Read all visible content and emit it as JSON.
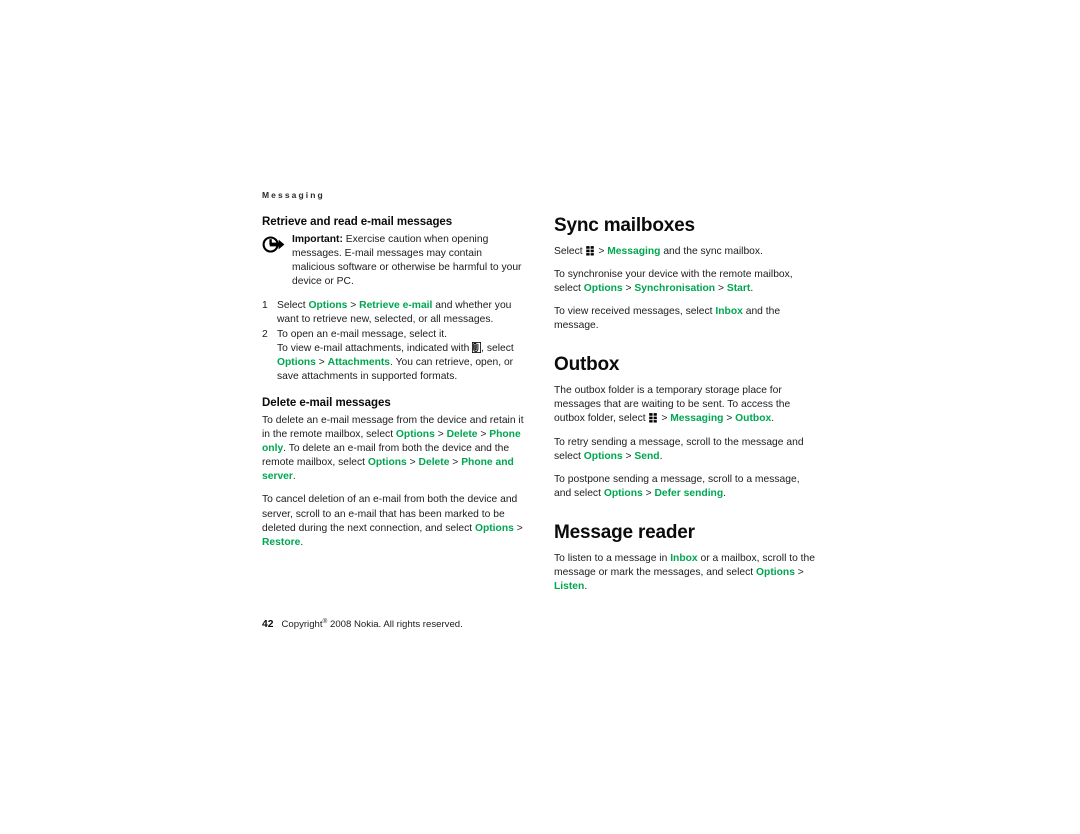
{
  "document": {
    "running_header": "Messaging",
    "accent_color": "#00a650",
    "text_color": "#1c1c1c"
  },
  "footer": {
    "page_number": "42",
    "copyright_pre": "Copyright",
    "registered_mark": "®",
    "copyright_post": "2008 Nokia. All rights reserved."
  },
  "left_column": {
    "section_retrieve": {
      "heading": "Retrieve and read e-mail messages",
      "note": {
        "icon": "important-arrow-icon",
        "label": "Important:",
        "text": " Exercise caution when opening messages. E-mail messages may contain malicious software or otherwise be harmful to your device or PC."
      },
      "steps": [
        {
          "num": "1",
          "t1": "Select ",
          "ui1": "Options",
          "sep1": " > ",
          "ui2": "Retrieve e-mail",
          "t2": " and whether you want to retrieve new, selected, or all messages."
        },
        {
          "num": "2",
          "t1": "To open an e-mail message, select it.",
          "t2": "To view e-mail attachments, indicated with ",
          "icon": "attachment-paperclip-icon",
          "t3": ", select ",
          "ui1": "Options",
          "sep1": " > ",
          "ui2": "Attachments",
          "t4": ". You can retrieve, open, or save attachments in supported formats."
        }
      ]
    },
    "section_delete": {
      "heading": "Delete e-mail messages",
      "para1": {
        "t1": "To delete an e-mail message from the device and retain it in the remote mailbox, select ",
        "ui1": "Options",
        "sep1": " > ",
        "ui2": "Delete",
        "sep2": " > ",
        "ui3": "Phone only",
        "t2": ". To delete an e-mail from both the device and the remote mailbox, select ",
        "ui4": "Options",
        "sep3": " > ",
        "ui5": "Delete",
        "sep4": " > ",
        "ui6": "Phone and server",
        "t3": "."
      },
      "para2": {
        "t1": "To cancel deletion of an e-mail from both the device and server, scroll to an e-mail that has been marked to be deleted during the next connection, and select ",
        "ui1": "Options",
        "sep1": " > ",
        "ui2": "Restore",
        "t2": "."
      }
    }
  },
  "right_column": {
    "section_sync": {
      "heading": "Sync mailboxes",
      "para1": {
        "t1": "Select ",
        "icon": "menu-key-icon",
        "sep1": " > ",
        "ui1": "Messaging",
        "t2": " and the sync mailbox."
      },
      "para2": {
        "t1": "To synchronise your device with the remote mailbox, select ",
        "ui1": "Options",
        "sep1": " > ",
        "ui2": "Synchronisation",
        "sep2": " > ",
        "ui3": "Start",
        "t2": "."
      },
      "para3": {
        "t1": "To view received messages, select ",
        "ui1": "Inbox",
        "t2": " and the message."
      }
    },
    "section_outbox": {
      "heading": "Outbox",
      "para1": {
        "t1": "The outbox folder is a temporary storage place for messages that are waiting to be sent. To access the outbox folder, select ",
        "icon": "menu-key-icon",
        "sep1": " > ",
        "ui1": "Messaging",
        "sep2": " > ",
        "ui2": "Outbox",
        "t2": "."
      },
      "para2": {
        "t1": "To retry sending a message, scroll to the message and select ",
        "ui1": "Options",
        "sep1": " > ",
        "ui2": "Send",
        "t2": "."
      },
      "para3": {
        "t1": "To postpone sending a message, scroll to a message, and select ",
        "ui1": "Options",
        "sep1": " > ",
        "ui2": "Defer sending",
        "t2": "."
      }
    },
    "section_reader": {
      "heading": "Message reader",
      "para1": {
        "t1": "To listen to a message in ",
        "ui1": "Inbox",
        "t2": " or a mailbox, scroll to the message or mark the messages, and select ",
        "ui2": "Options",
        "sep1": " > ",
        "ui3": "Listen",
        "t3": "."
      }
    }
  }
}
